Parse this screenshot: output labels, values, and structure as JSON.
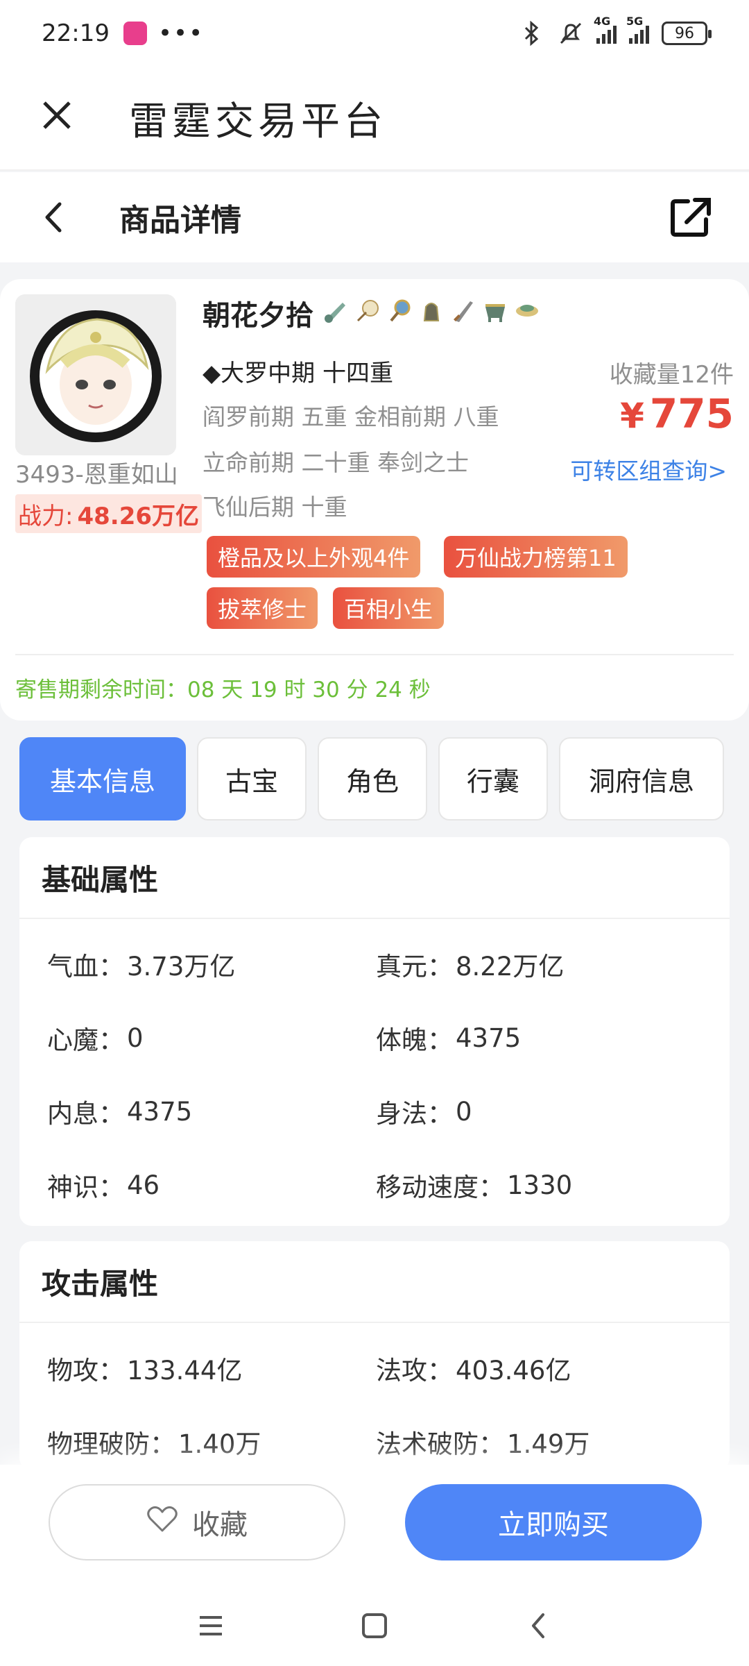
{
  "status_bar": {
    "time": "22:19",
    "dots": "•••",
    "battery": "96",
    "signal_1": "4G",
    "signal_2": "5G"
  },
  "app_bar": {
    "title": "雷霆交易平台"
  },
  "page_header": {
    "title": "商品详情"
  },
  "product": {
    "name": "朝花夕拾",
    "treasure_icons": [
      "gourd-icon",
      "fan-icon",
      "mace-icon",
      "bell-icon",
      "sword-icon",
      "cauldron-icon",
      "bowl-icon"
    ],
    "realm": "◆大罗中期 十四重",
    "realm_line_1": "阎罗前期 五重 金相前期 八重",
    "realm_line_2": "立命前期 二十重 奉剑之士",
    "realm_line_3": "飞仙后期 十重",
    "seller": "3493-恩重如山",
    "power_label": "战力:",
    "power_value": "48.26万亿",
    "favorites": "收藏量12件",
    "price_symbol": "¥",
    "price": "775",
    "transfer_link": "可转区组查询>",
    "tags": [
      "橙品及以上外观4件",
      "万仙战力榜第11",
      "拔萃修士",
      "百相小生"
    ],
    "countdown": "寄售期剩余时间：08 天 19 时 30 分 24 秒"
  },
  "tabs": [
    {
      "label": "基本信息",
      "active": true
    },
    {
      "label": "古宝",
      "active": false
    },
    {
      "label": "角色",
      "active": false
    },
    {
      "label": "行囊",
      "active": false
    },
    {
      "label": "洞府信息",
      "active": false
    }
  ],
  "basic_attributes": {
    "title": "基础属性",
    "items": [
      {
        "key": "气血：",
        "value": "3.73万亿"
      },
      {
        "key": "真元：",
        "value": "8.22万亿"
      },
      {
        "key": "心魔：",
        "value": "0"
      },
      {
        "key": "体魄：",
        "value": "4375"
      },
      {
        "key": "内息：",
        "value": "4375"
      },
      {
        "key": "身法：",
        "value": "0"
      },
      {
        "key": "神识：",
        "value": "46"
      },
      {
        "key": "移动速度：",
        "value": "1330"
      }
    ]
  },
  "attack_attributes": {
    "title": "攻击属性",
    "items": [
      {
        "key": "物攻：",
        "value": "133.44亿"
      },
      {
        "key": "法攻：",
        "value": "403.46亿"
      },
      {
        "key": "物理破防：",
        "value": "1.40万"
      },
      {
        "key": "法术破防：",
        "value": "1.49万"
      }
    ]
  },
  "actions": {
    "favorite": "收藏",
    "buy": "立即购买"
  },
  "colors": {
    "accent_blue": "#4f86f7",
    "price_red": "#e5473a",
    "countdown_green": "#6cbf3a",
    "link_blue": "#3d82e6"
  }
}
